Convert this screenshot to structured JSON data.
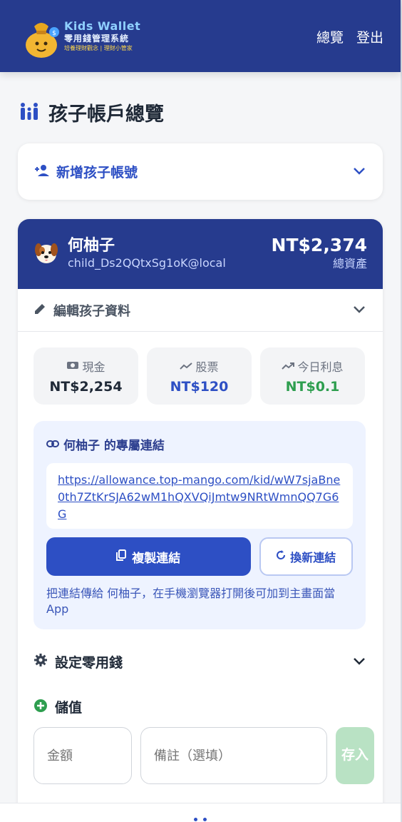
{
  "header": {
    "logo_title": "Kids Wallet",
    "logo_subtitle": "零用錢管理系統",
    "logo_tagline": "培養理財觀念 | 理財小管家",
    "nav": [
      "總覽",
      "登出"
    ]
  },
  "page": {
    "title": "孩子帳戶總覽"
  },
  "add_child": {
    "label": "新增孩子帳號"
  },
  "child": {
    "name": "何柚子",
    "email": "child_Ds2QQtxSg1oK@local",
    "total": "NT$2,374",
    "total_label": "總資產",
    "edit_label": "編輯孩子資料",
    "stats": [
      {
        "label": "現金",
        "value": "NT$2,254",
        "color": "#1f2937",
        "icon": "cash-icon"
      },
      {
        "label": "股票",
        "value": "NT$120",
        "color": "#2d4fc4",
        "icon": "trend-icon"
      },
      {
        "label": "今日利息",
        "value": "NT$0.1",
        "color": "#2e9e4f",
        "icon": "trend-up-icon"
      }
    ],
    "link": {
      "title": "何柚子 的專屬連結",
      "url": "https://allowance.top-mango.com/kid/wW7sjaBne0th7ZtKrSJA62wM1hQXVQiJmtw9NRtWmnQQ7G6G",
      "copy_label": "複製連結",
      "renew_label": "換新連結",
      "hint": "把連結傳給 何柚子，在手機瀏覽器打開後可加到主畫面當 App"
    },
    "allowance_label": "設定零用錢",
    "deposit_label": "儲值",
    "amount_placeholder": "金額",
    "note_placeholder": "備註（選填）",
    "save_label": "存入"
  }
}
